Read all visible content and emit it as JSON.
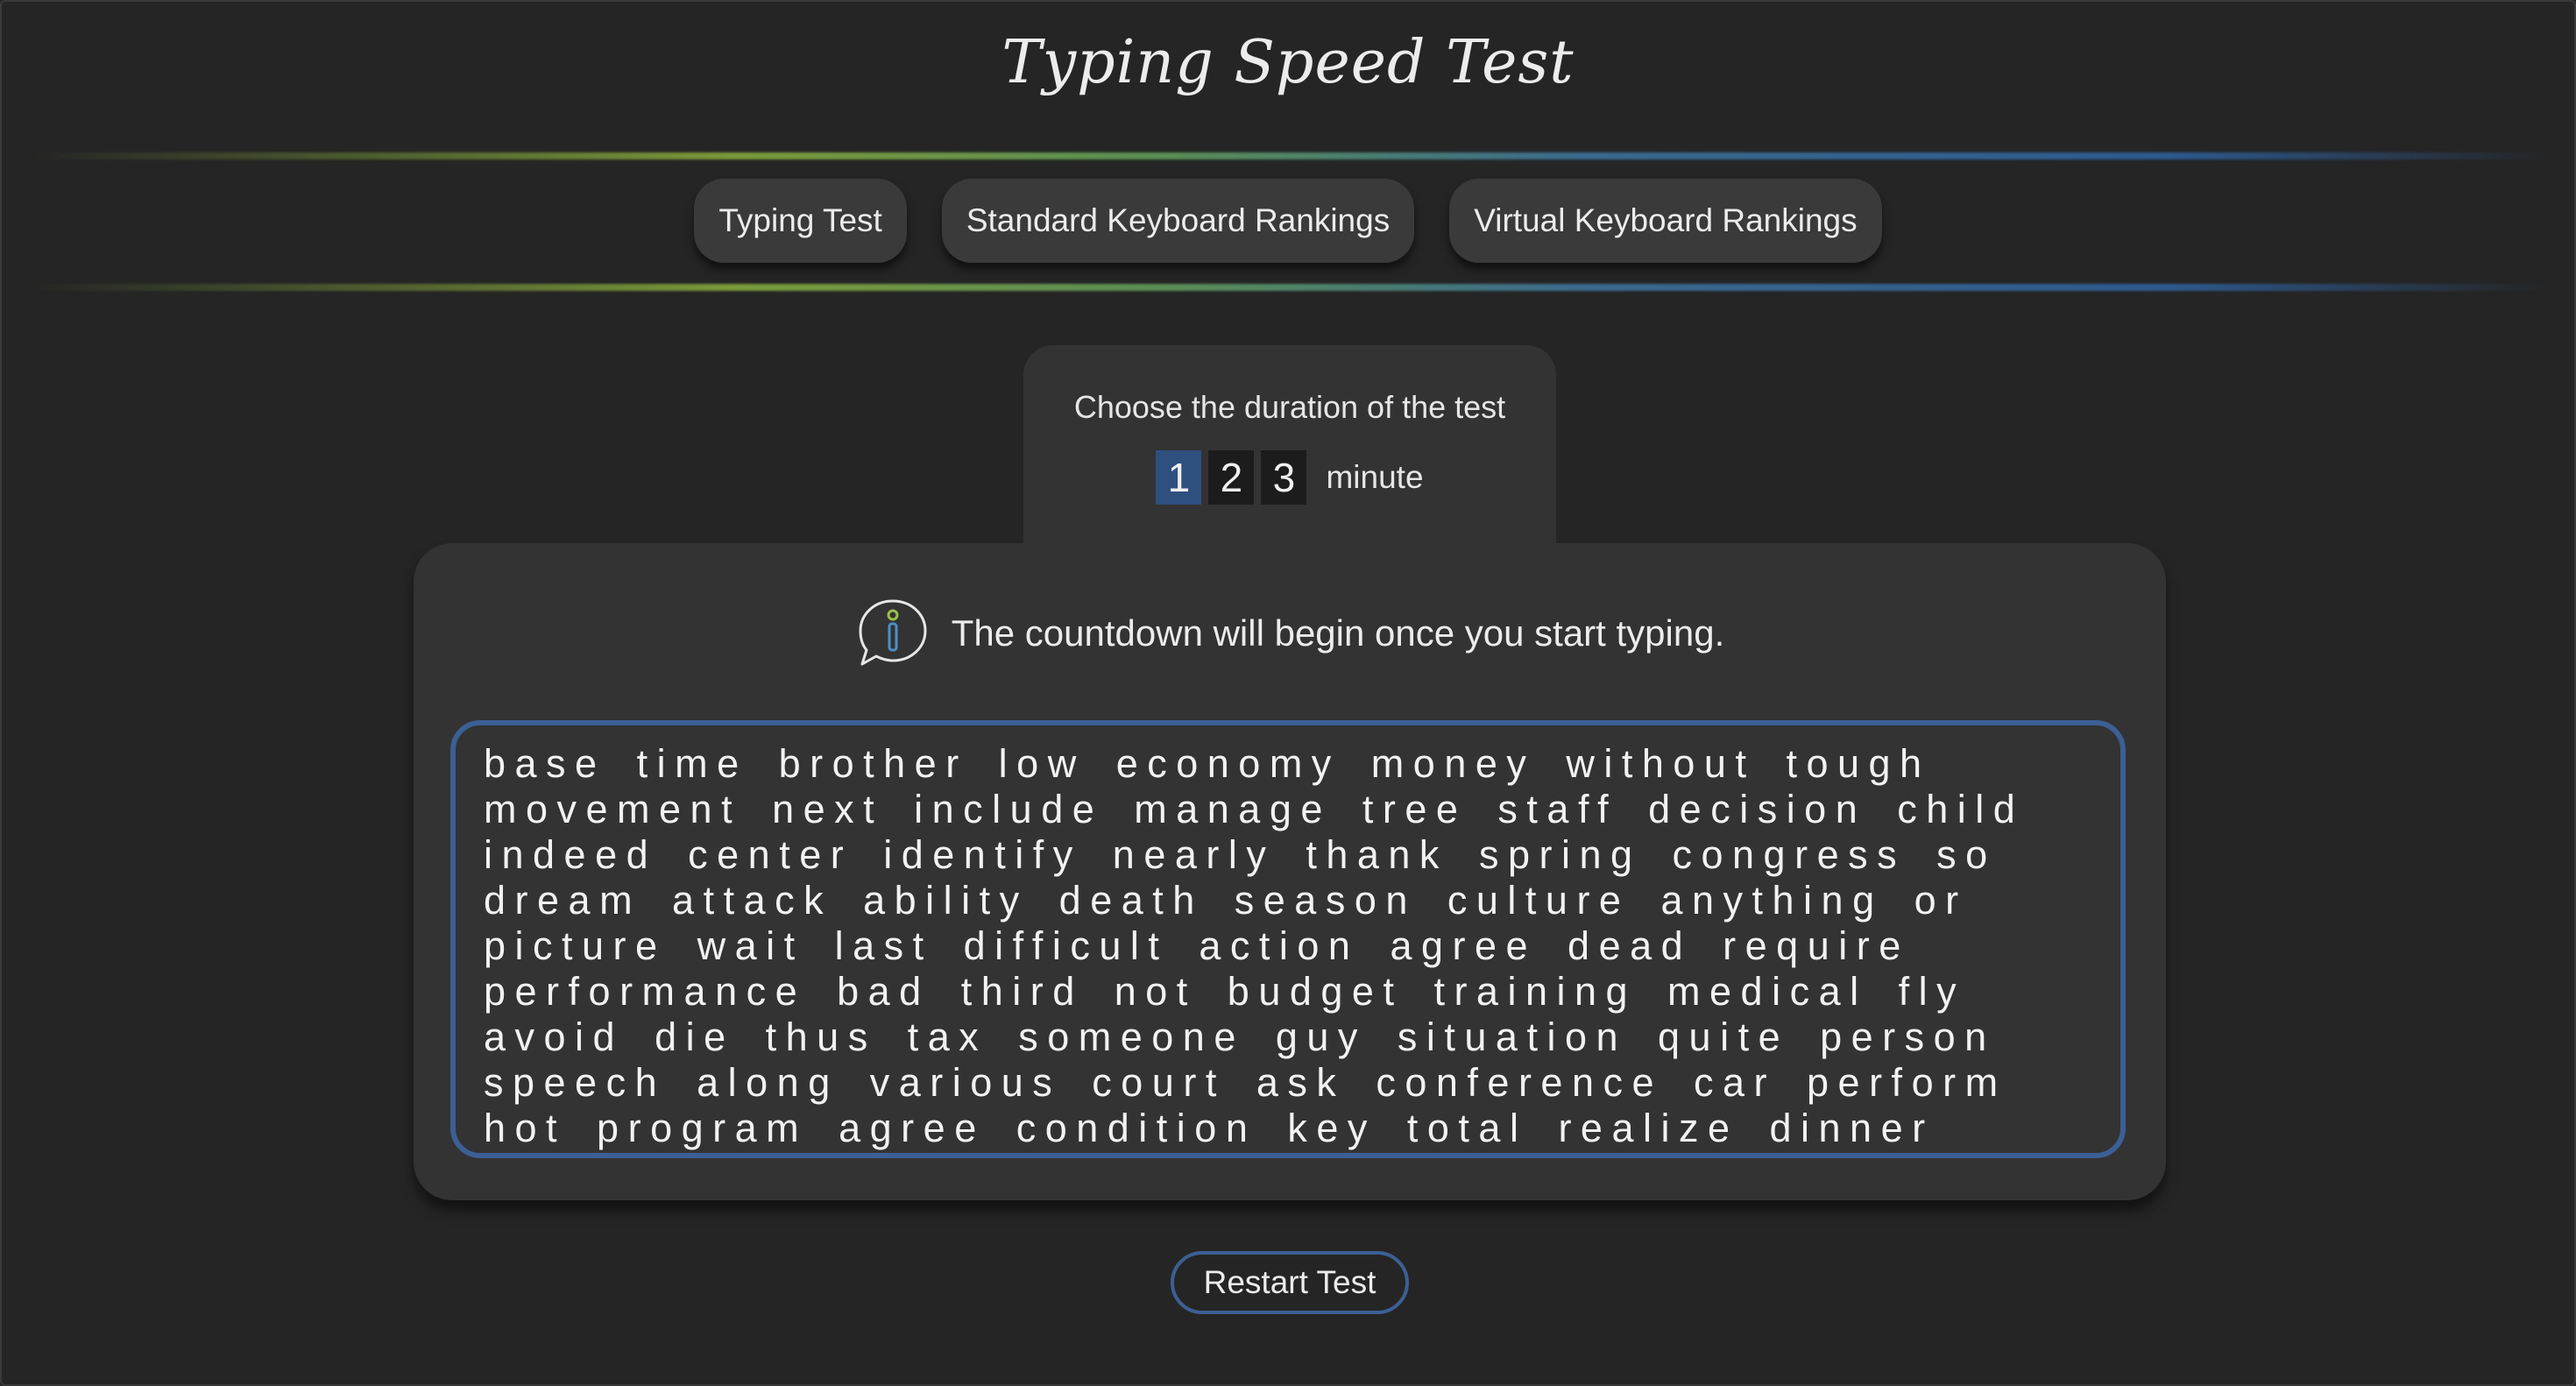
{
  "header": {
    "title": "Typing Speed Test"
  },
  "nav": {
    "items": [
      {
        "label": "Typing Test"
      },
      {
        "label": "Standard Keyboard Rankings"
      },
      {
        "label": "Virtual Keyboard Rankings"
      }
    ]
  },
  "duration": {
    "label": "Choose the duration of the test",
    "options": [
      "1",
      "2",
      "3"
    ],
    "selected": "1",
    "unit": "minute"
  },
  "info": {
    "icon": "info-speech-bubble-icon",
    "text": "The countdown will begin once you start typing."
  },
  "words": {
    "text": "base time brother low economy money without tough movement next include manage tree staff decision child indeed center identify nearly thank spring congress so dream attack ability death season culture anything or picture wait last difficult action agree dead require performance bad third not budget training medical fly avoid die thus tax someone guy situation quite person speech along various court ask conference car perform hot program agree condition key total realize dinner"
  },
  "actions": {
    "restart_label": "Restart Test"
  },
  "colors": {
    "background": "#252525",
    "panel": "#333333",
    "accent_blue": "#3c5f95",
    "selected_duration": "#2f4f7f"
  }
}
